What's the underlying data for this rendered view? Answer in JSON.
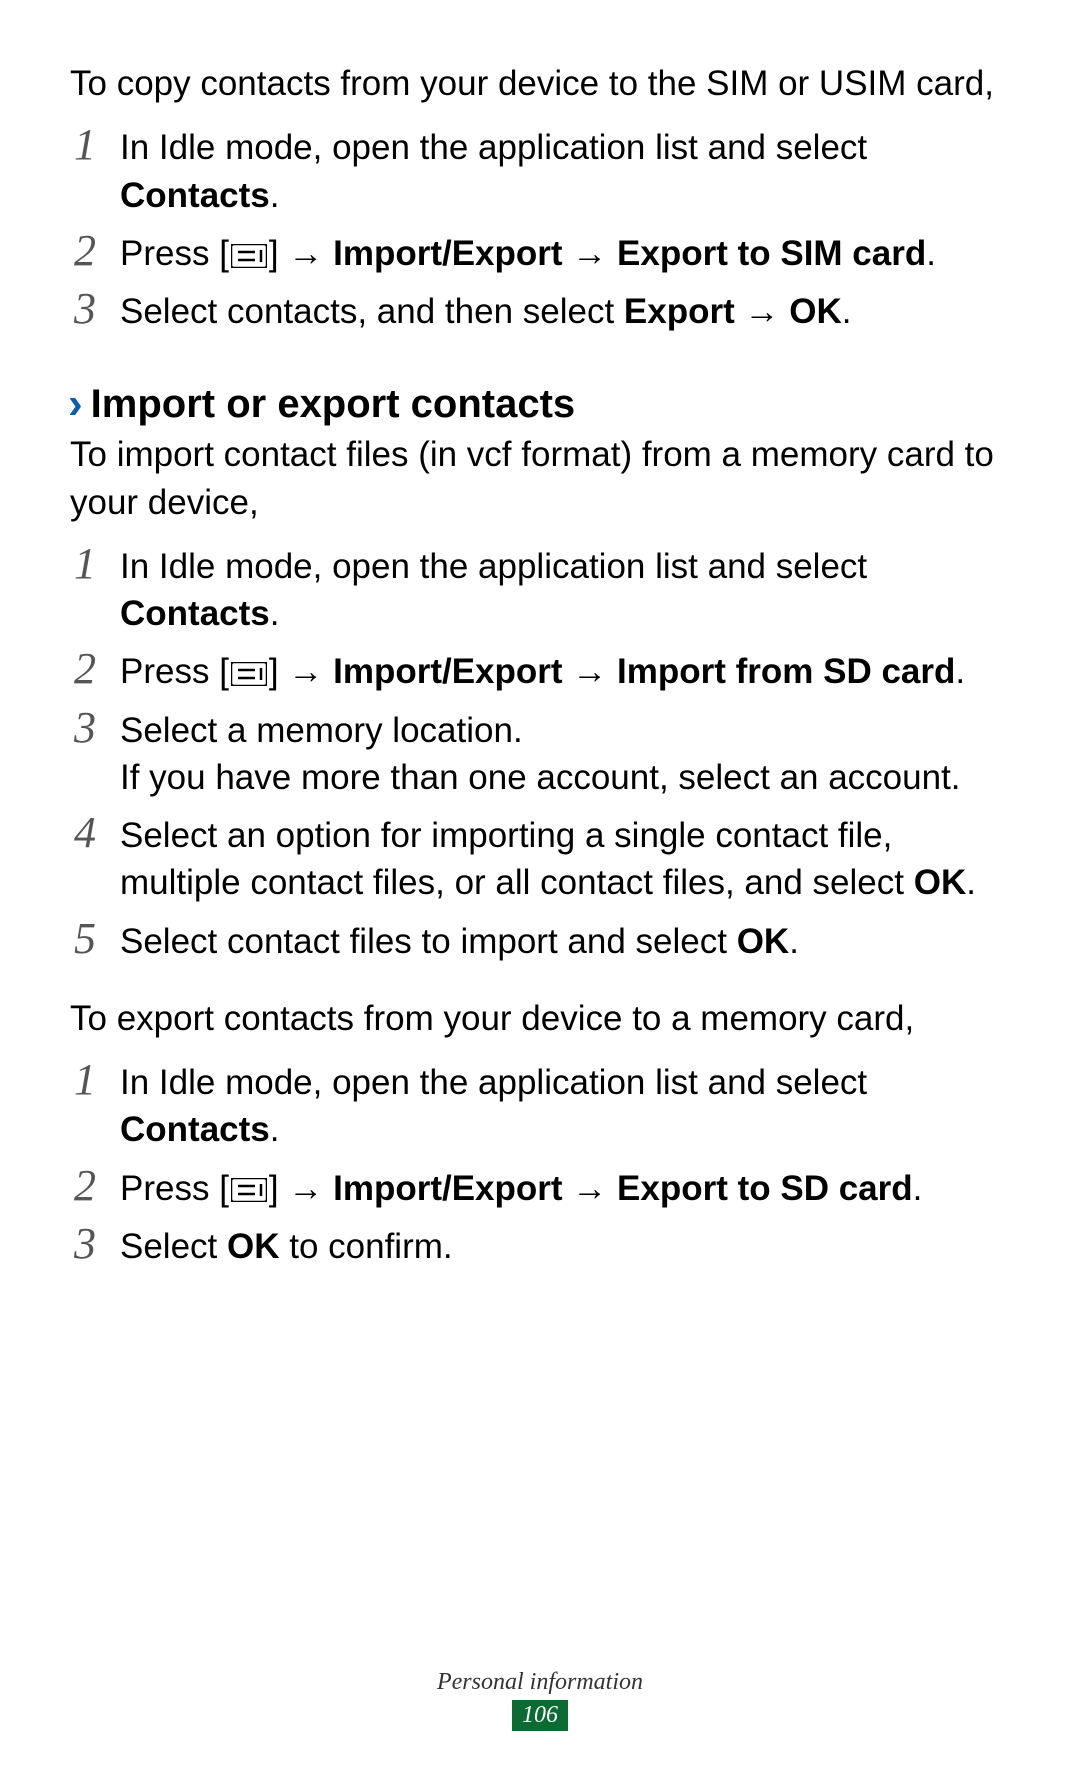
{
  "intro1": "To copy contacts from your device to the SIM or USIM card,",
  "list1_step1_a": "In Idle mode, open the application list and select ",
  "list1_step1_b": "Contacts",
  "list1_step1_c": ".",
  "list1_step2_a": "Press [",
  "list1_step2_b": "] → ",
  "list1_step2_c": "Import/Export",
  "list1_step2_d": " → ",
  "list1_step2_e": "Export to SIM card",
  "list1_step2_f": ".",
  "list1_step3_a": "Select contacts, and then select ",
  "list1_step3_b": "Export",
  "list1_step3_c": " → ",
  "list1_step3_d": "OK",
  "list1_step3_e": ".",
  "heading": "Import or export contacts",
  "intro2": "To import contact files (in vcf format) from a memory card to your device,",
  "list2_step1_a": "In Idle mode, open the application list and select ",
  "list2_step1_b": "Contacts",
  "list2_step1_c": ".",
  "list2_step2_a": "Press [",
  "list2_step2_b": "] → ",
  "list2_step2_c": "Import/Export",
  "list2_step2_d": " → ",
  "list2_step2_e": "Import from SD card",
  "list2_step2_f": ".",
  "list2_step3_a": "Select a memory location.",
  "list2_step3_b": "If you have more than one account, select an account.",
  "list2_step4_a": "Select an option for importing a single contact file, multiple contact files, or all contact files, and select ",
  "list2_step4_b": "OK",
  "list2_step4_c": ".",
  "list2_step5_a": "Select contact files to import and select ",
  "list2_step5_b": "OK",
  "list2_step5_c": ".",
  "intro3": "To export contacts from your device to a memory card,",
  "list3_step1_a": "In Idle mode, open the application list and select ",
  "list3_step1_b": "Contacts",
  "list3_step1_c": ".",
  "list3_step2_a": "Press [",
  "list3_step2_b": "] → ",
  "list3_step2_c": "Import/Export",
  "list3_step2_d": " → ",
  "list3_step2_e": "Export to SD card",
  "list3_step2_f": ".",
  "list3_step3_a": "Select ",
  "list3_step3_b": "OK",
  "list3_step3_c": " to confirm.",
  "footer_section": "Personal information",
  "page_number": "106",
  "num1": "1",
  "num2": "2",
  "num3": "3",
  "num4": "4",
  "num5": "5",
  "chevron": "›"
}
